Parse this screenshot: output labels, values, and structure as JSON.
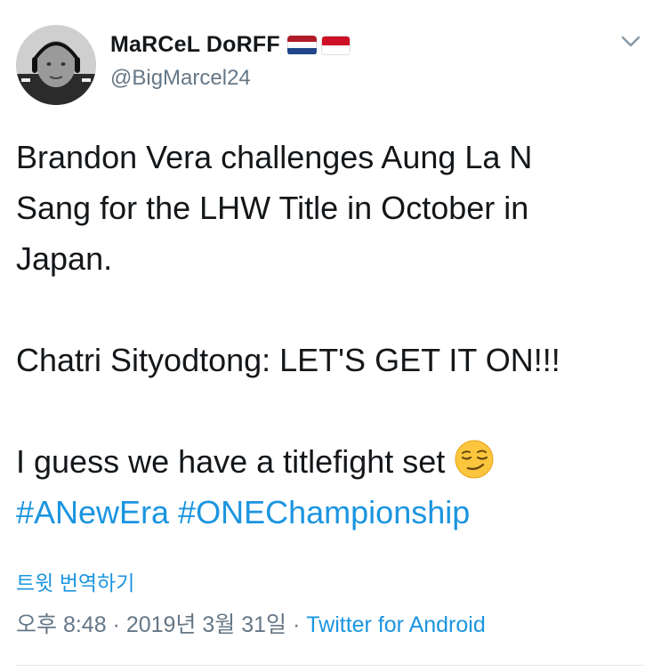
{
  "tweet": {
    "author": {
      "display_name": "MaRCeL DoRFF",
      "handle": "@BigMarcel24",
      "flags": [
        {
          "colors": [
            "#ae1c28",
            "#ffffff",
            "#21468b"
          ]
        },
        {
          "colors": [
            "#ce1126",
            "#ffffff"
          ]
        }
      ]
    },
    "text": {
      "line1": "Brandon Vera challenges Aung La N",
      "line2": "Sang for the LHW Title in October in",
      "line3": "Japan.",
      "line4": "Chatri Sityodtong: LET'S GET IT ON!!!",
      "line5": "I guess we have a titlefight set",
      "emoji": "smirking-face",
      "hashtags": [
        "#ANewEra",
        "#ONEChampionship"
      ]
    },
    "translate_label": "트윗 번역하기",
    "timestamp": "오후 8:48 · 2019년 3월 31일 ·",
    "source": "Twitter for Android"
  },
  "colors": {
    "link": "#1b95e0",
    "secondary_text": "#657786",
    "primary_text": "#14171a"
  }
}
